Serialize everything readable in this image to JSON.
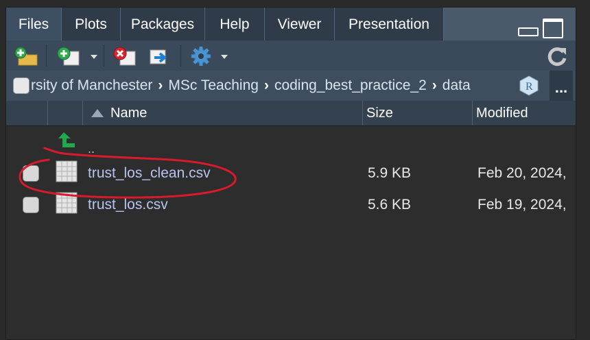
{
  "tabs": [
    {
      "label": "Files",
      "active": true
    },
    {
      "label": "Plots",
      "active": false
    },
    {
      "label": "Packages",
      "active": false
    },
    {
      "label": "Help",
      "active": false
    },
    {
      "label": "Viewer",
      "active": false
    },
    {
      "label": "Presentation",
      "active": false
    }
  ],
  "toolbar": {
    "icons": [
      "new-folder-icon",
      "new-blank-file-icon",
      "delete-icon",
      "rename-icon",
      "gear-icon",
      "refresh-icon"
    ]
  },
  "breadcrumb": {
    "items": [
      "rsity of Manchester",
      "MSc Teaching",
      "coding_best_practice_2",
      "data"
    ],
    "more": "..."
  },
  "table": {
    "columns": {
      "name": "Name",
      "size": "Size",
      "modified": "Modified"
    },
    "up_label": "..",
    "rows": [
      {
        "name": "trust_los_clean.csv",
        "size": "5.9 KB",
        "modified": "Feb 20, 2024,"
      },
      {
        "name": "trust_los.csv",
        "size": "5.6 KB",
        "modified": "Feb 19, 2024,"
      }
    ]
  },
  "colors": {
    "annotation": "#d81b2c",
    "filename": "#b9c3f0",
    "tab_active": "#3c4f63"
  }
}
